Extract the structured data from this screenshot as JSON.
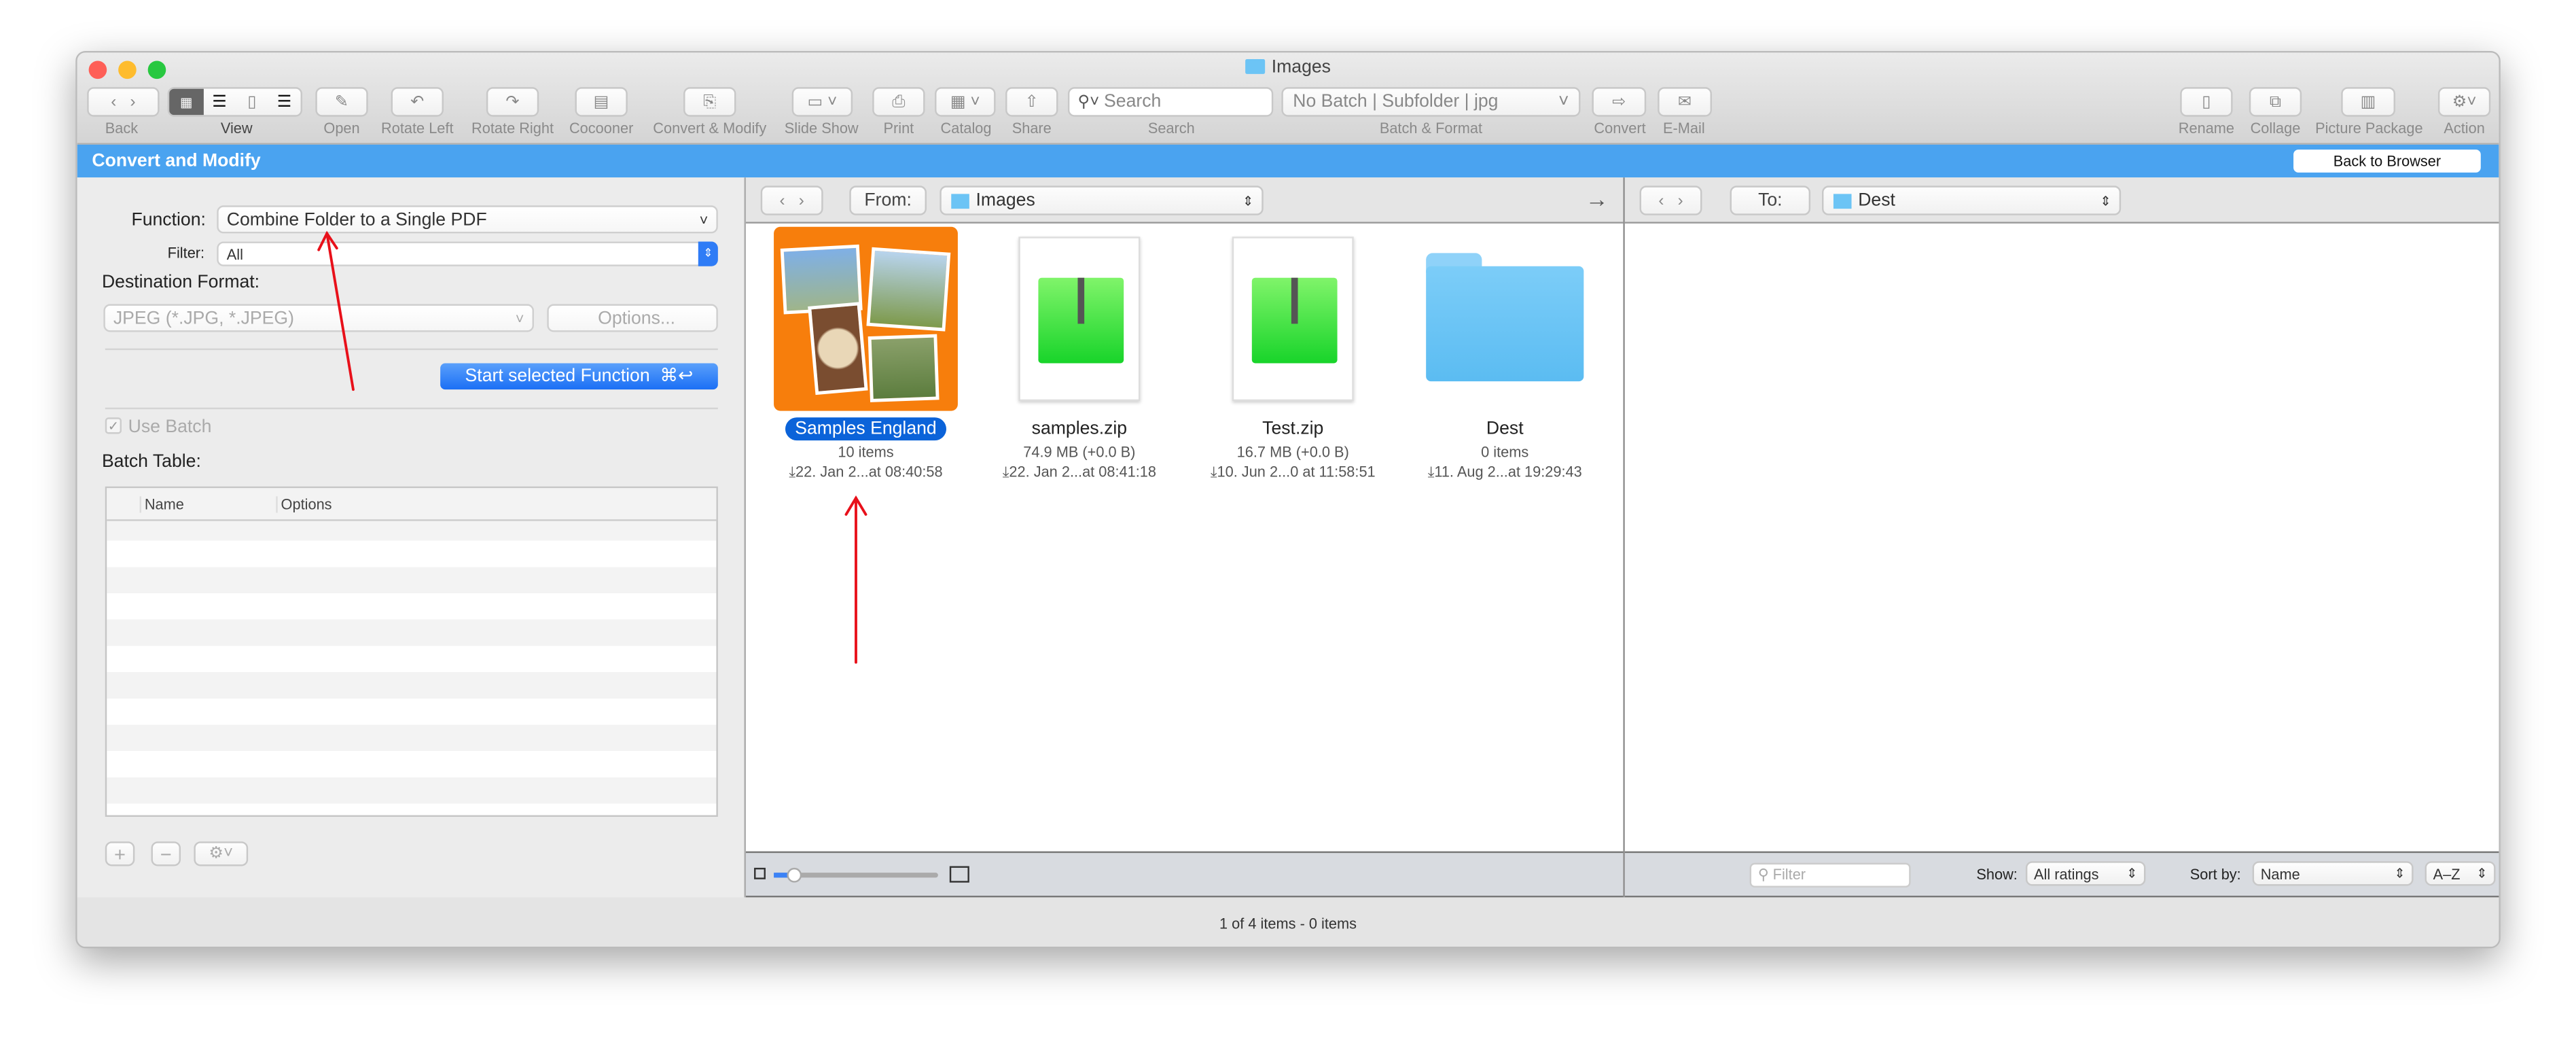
{
  "window": {
    "title": "Images"
  },
  "toolbar": {
    "items": [
      {
        "label": "Back",
        "icon": "chevron-left-right-icon"
      },
      {
        "label": "View",
        "icon": "view-mode-icon"
      },
      {
        "label": "Open",
        "icon": "open-icon"
      },
      {
        "label": "Rotate Left",
        "icon": "rotate-left-icon"
      },
      {
        "label": "Rotate Right",
        "icon": "rotate-right-icon"
      },
      {
        "label": "Cocooner",
        "icon": "cocooner-icon"
      },
      {
        "label": "Convert & Modify",
        "icon": "convert-modify-icon"
      },
      {
        "label": "Slide Show",
        "icon": "slideshow-icon"
      },
      {
        "label": "Print",
        "icon": "print-icon"
      },
      {
        "label": "Catalog",
        "icon": "catalog-icon"
      },
      {
        "label": "Share",
        "icon": "share-icon"
      },
      {
        "label": "Search",
        "icon": "search-icon"
      },
      {
        "label": "Batch & Format",
        "icon": ""
      },
      {
        "label": "Convert",
        "icon": "convert-icon"
      },
      {
        "label": "E-Mail",
        "icon": "mail-icon"
      },
      {
        "label": "Rename",
        "icon": "rename-icon"
      },
      {
        "label": "Collage",
        "icon": "collage-icon"
      },
      {
        "label": "Picture Package",
        "icon": "picture-package-icon"
      },
      {
        "label": "Action",
        "icon": "gear-icon"
      }
    ],
    "search_placeholder": "Search",
    "batch_value": "No Batch | Subfolder | jpg"
  },
  "banner": {
    "title": "Convert and Modify",
    "back_button": "Back to Browser",
    "color": "#4aa3f0"
  },
  "left": {
    "function_label": "Function:",
    "function_value": "Combine Folder to a Single PDF",
    "filter_label": "Filter:",
    "filter_value": "All",
    "dest_label": "Destination Format:",
    "dest_value": "JPEG (*.JPG, *.JPEG)",
    "options_button": "Options...",
    "start_button": "Start selected Function",
    "start_shortcut": "⌘↩",
    "use_batch": "Use Batch",
    "use_batch_checked": true,
    "batch_table_label": "Batch Table:",
    "columns": [
      "Name",
      "Options"
    ]
  },
  "source": {
    "from_label": "From:",
    "folder": "Images",
    "files": [
      {
        "name": "Samples England",
        "info": "10 items",
        "date": "22. Jan 2...at 08:40:58",
        "type": "folder-thumb",
        "selected": true
      },
      {
        "name": "samples.zip",
        "info": "74.9 MB (+0.0 B)",
        "date": "22. Jan 2...at 08:41:18",
        "type": "zip"
      },
      {
        "name": "Test.zip",
        "info": "16.7 MB (+0.0 B)",
        "date": "10. Jun 2...0 at 11:58:51",
        "type": "zip"
      },
      {
        "name": "Dest",
        "info": "0 items",
        "date": "11. Aug 2...at 19:29:43",
        "type": "folder"
      }
    ]
  },
  "dest": {
    "to_label": "To:",
    "folder": "Dest"
  },
  "bottom": {
    "filter_placeholder": "Filter",
    "show_label": "Show:",
    "show_value": "All ratings",
    "sort_label": "Sort by:",
    "sort_value": "Name",
    "order_value": "A–Z",
    "thumb_size": 0.12
  },
  "status": "1 of 4 items - 0 items"
}
